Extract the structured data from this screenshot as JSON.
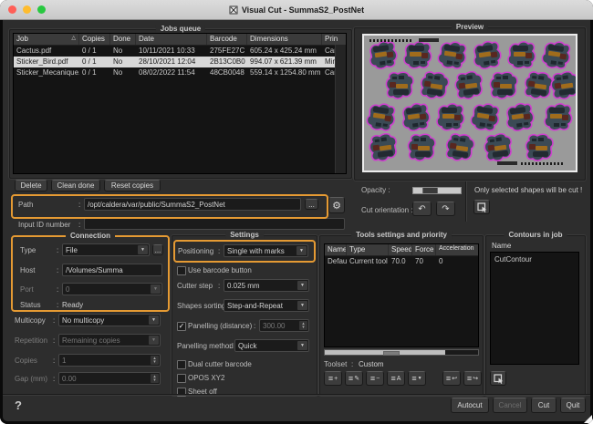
{
  "ui": {
    "colon": ":"
  },
  "icons": {
    "gear": "⚙",
    "undo": "↶",
    "redo": "↷",
    "dropdown": "▼",
    "spin_up": "▴",
    "spin_down": "▾",
    "sort": "△",
    "check": "✓",
    "browse": "...",
    "list": "≡",
    "add": "+",
    "edit": "✎",
    "remove": "−",
    "sort_alpha": "A",
    "sort_order": "▼",
    "import": "↩",
    "export": "↪"
  },
  "titlebar": {
    "title": "Visual Cut - SummaS2_PostNet"
  },
  "jobs_queue": {
    "title": "Jobs queue",
    "columns": [
      "Job",
      "Copies",
      "Done",
      "Date",
      "Barcode",
      "Dimensions",
      "Prin"
    ],
    "rows": [
      [
        "Cactus.pdf",
        "0 / 1",
        "No",
        "10/11/2021 10:33",
        "275FE27C",
        "605.24 x 425.24 mm",
        "Car"
      ],
      [
        "Sticker_Bird.pdf",
        "0 / 1",
        "No",
        "28/10/2021 12:04",
        "2B13C0B0",
        "994.07 x 621.39 mm",
        "Mim"
      ],
      [
        "Sticker_Mecanique.pdf",
        "0 / 1",
        "No",
        "08/02/2022 11:54",
        "48CB0048",
        "559.14 x 1254.80 mm",
        "Car"
      ]
    ],
    "selected_row_index": 1,
    "buttons": [
      "Delete",
      "Clean done",
      "Reset copies"
    ]
  },
  "path_row": {
    "label": "Path",
    "value": "/opt/caldera/var/public/SummaS2_PostNet"
  },
  "input_id_row": {
    "label": "Input ID number",
    "value": ""
  },
  "connection": {
    "title": "Connection",
    "type": {
      "label": "Type",
      "value": "File"
    },
    "host": {
      "label": "Host",
      "value": "/Volumes/Summa"
    },
    "port": {
      "label": "Port",
      "value": "0"
    },
    "status": {
      "label": "Status",
      "value": "Ready"
    }
  },
  "output_options": {
    "multicopy": {
      "label": "Multicopy",
      "value": "No multicopy"
    },
    "repetition": {
      "label": "Repetition",
      "value": "Remaining copies"
    },
    "copies": {
      "label": "Copies",
      "value": "1"
    },
    "gap": {
      "label": "Gap (mm)",
      "value": "0.00"
    }
  },
  "settings": {
    "title": "Settings",
    "positioning": {
      "label": "Positioning",
      "value": "Single with marks"
    },
    "use_barcode": {
      "label": "Use barcode button",
      "checked": false
    },
    "cutter_step": {
      "label": "Cutter step",
      "value": "0.025 mm"
    },
    "shapes_sorting": {
      "label": "Shapes sorting",
      "value": "Step-and-Repeat"
    },
    "panelling": {
      "label": "Panelling (distance)",
      "value": "300.00",
      "checked": true
    },
    "panelling_method": {
      "label": "Panelling method",
      "value": "Quick"
    },
    "dual_cutter": {
      "label": "Dual cutter barcode",
      "checked": false
    },
    "opos": {
      "label": "OPOS XY2",
      "checked": false
    },
    "sheet_off": {
      "label": "Sheet off",
      "checked": false
    }
  },
  "tools": {
    "title": "Tools settings and priority",
    "columns": [
      "Name",
      "Type",
      "Speed",
      "Force",
      "Acceleration"
    ],
    "rows": [
      [
        "Default",
        "Current tool",
        "70.0",
        "70",
        "0"
      ]
    ],
    "toolset_label": "Toolset",
    "toolset_value": "Custom"
  },
  "contours": {
    "title": "Contours in job",
    "column_header": "Name",
    "items": [
      "CutContour"
    ]
  },
  "preview": {
    "title": "Preview",
    "opacity_label": "Opacity :",
    "cut_orientation_label": "Cut orientation :",
    "notice": "Only selected shapes will be cut !"
  },
  "footer": {
    "help": "?",
    "autocut": "Autocut",
    "cancel": "Cancel",
    "cut": "Cut",
    "quit": "Quit"
  },
  "colors": {
    "highlight": "#e59a33",
    "contour": "#cf3fcf",
    "selected_row_bg": "#d8d8d8",
    "traffic_close": "#ff5f57",
    "traffic_minimize": "#febc2e",
    "traffic_zoom": "#28c840",
    "preview_media": "#9a9a9a"
  }
}
